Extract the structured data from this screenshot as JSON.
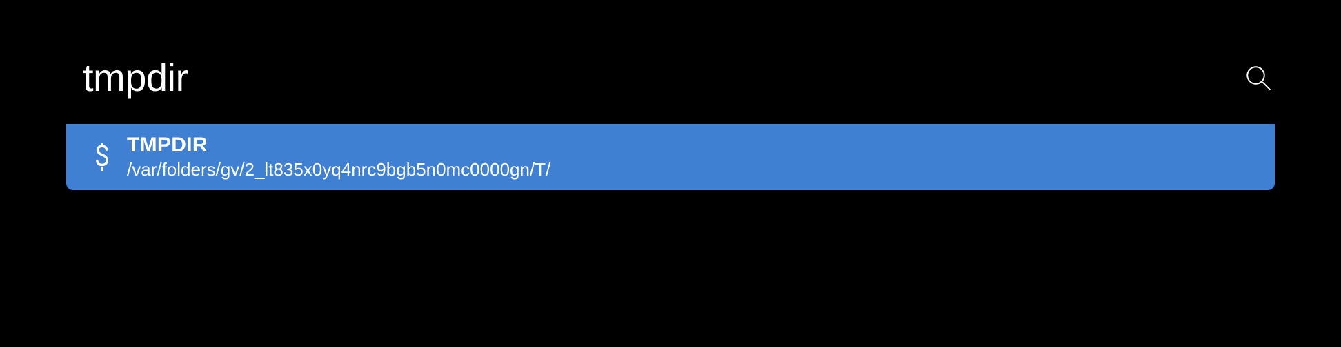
{
  "search": {
    "query": "tmpdir",
    "placeholder": ""
  },
  "result": {
    "icon_name": "dollar-icon",
    "title": "TMPDIR",
    "subtitle": "/var/folders/gv/2_lt835x0yq4nrc9bgb5n0mc0000gn/T/"
  },
  "colors": {
    "selection": "#4080d2",
    "background": "#000000",
    "text": "#ffffff"
  }
}
